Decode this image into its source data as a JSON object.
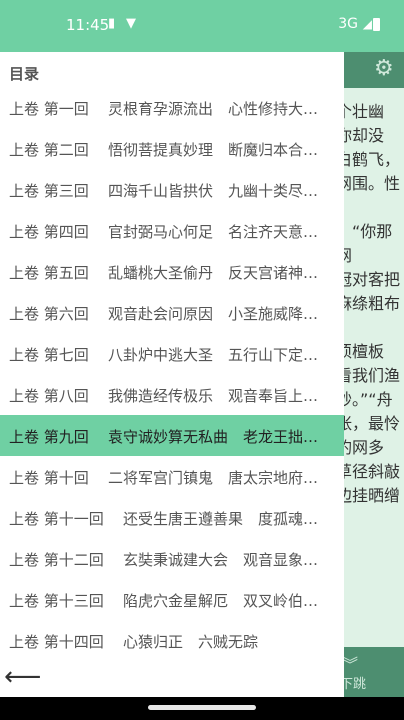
{
  "status": {
    "time": "11:45",
    "network": "3G"
  },
  "reader_fragments": [
    "个壮幽",
    "你却没",
    "白鹤飞，",
    "网围。性",
    "",
    "：“你那",
    "网",
    "冠对客把",
    "麻绦粗布",
    "",
    "须檀板",
    "看我们渔",
    "钞。”“舟",
    "张，最怜",
    "钓网多",
    "草径斜敲",
    "边挂晒缯"
  ],
  "reader_bottom": {
    "next_label": "下跳"
  },
  "toc": {
    "title": "目录",
    "items": [
      {
        "chapter": "上卷 第一回",
        "subtitle": "灵根育孕源流出　心性修持大…",
        "active": false
      },
      {
        "chapter": "上卷 第二回",
        "subtitle": "悟彻菩提真妙理　断魔归本合…",
        "active": false
      },
      {
        "chapter": "上卷 第三回",
        "subtitle": "四海千山皆拱伏　九幽十类尽…",
        "active": false
      },
      {
        "chapter": "上卷 第四回",
        "subtitle": "官封弼马心何足　名注齐天意…",
        "active": false
      },
      {
        "chapter": "上卷 第五回",
        "subtitle": "乱蟠桃大圣偷丹　反天宫诸神…",
        "active": false
      },
      {
        "chapter": "上卷 第六回",
        "subtitle": "观音赴会问原因　小圣施威降…",
        "active": false
      },
      {
        "chapter": "上卷 第七回",
        "subtitle": "八卦炉中逃大圣　五行山下定…",
        "active": false
      },
      {
        "chapter": "上卷 第八回",
        "subtitle": "我佛造经传极乐　观音奉旨上…",
        "active": false
      },
      {
        "chapter": "上卷 第九回",
        "subtitle": "袁守诚妙算无私曲　老龙王拙…",
        "active": true
      },
      {
        "chapter": "上卷 第十回",
        "subtitle": "二将军宫门镇鬼　唐太宗地府…",
        "active": false
      },
      {
        "chapter": "上卷 第十一回",
        "subtitle": "还受生唐王遵善果　度孤魂…",
        "active": false
      },
      {
        "chapter": "上卷 第十二回",
        "subtitle": "玄奘秉诚建大会　观音显象…",
        "active": false
      },
      {
        "chapter": "上卷 第十三回",
        "subtitle": "陷虎穴金星解厄　双叉岭伯…",
        "active": false
      },
      {
        "chapter": "上卷 第十四回",
        "subtitle": "心猿归正　六贼无踪",
        "active": false
      }
    ]
  }
}
